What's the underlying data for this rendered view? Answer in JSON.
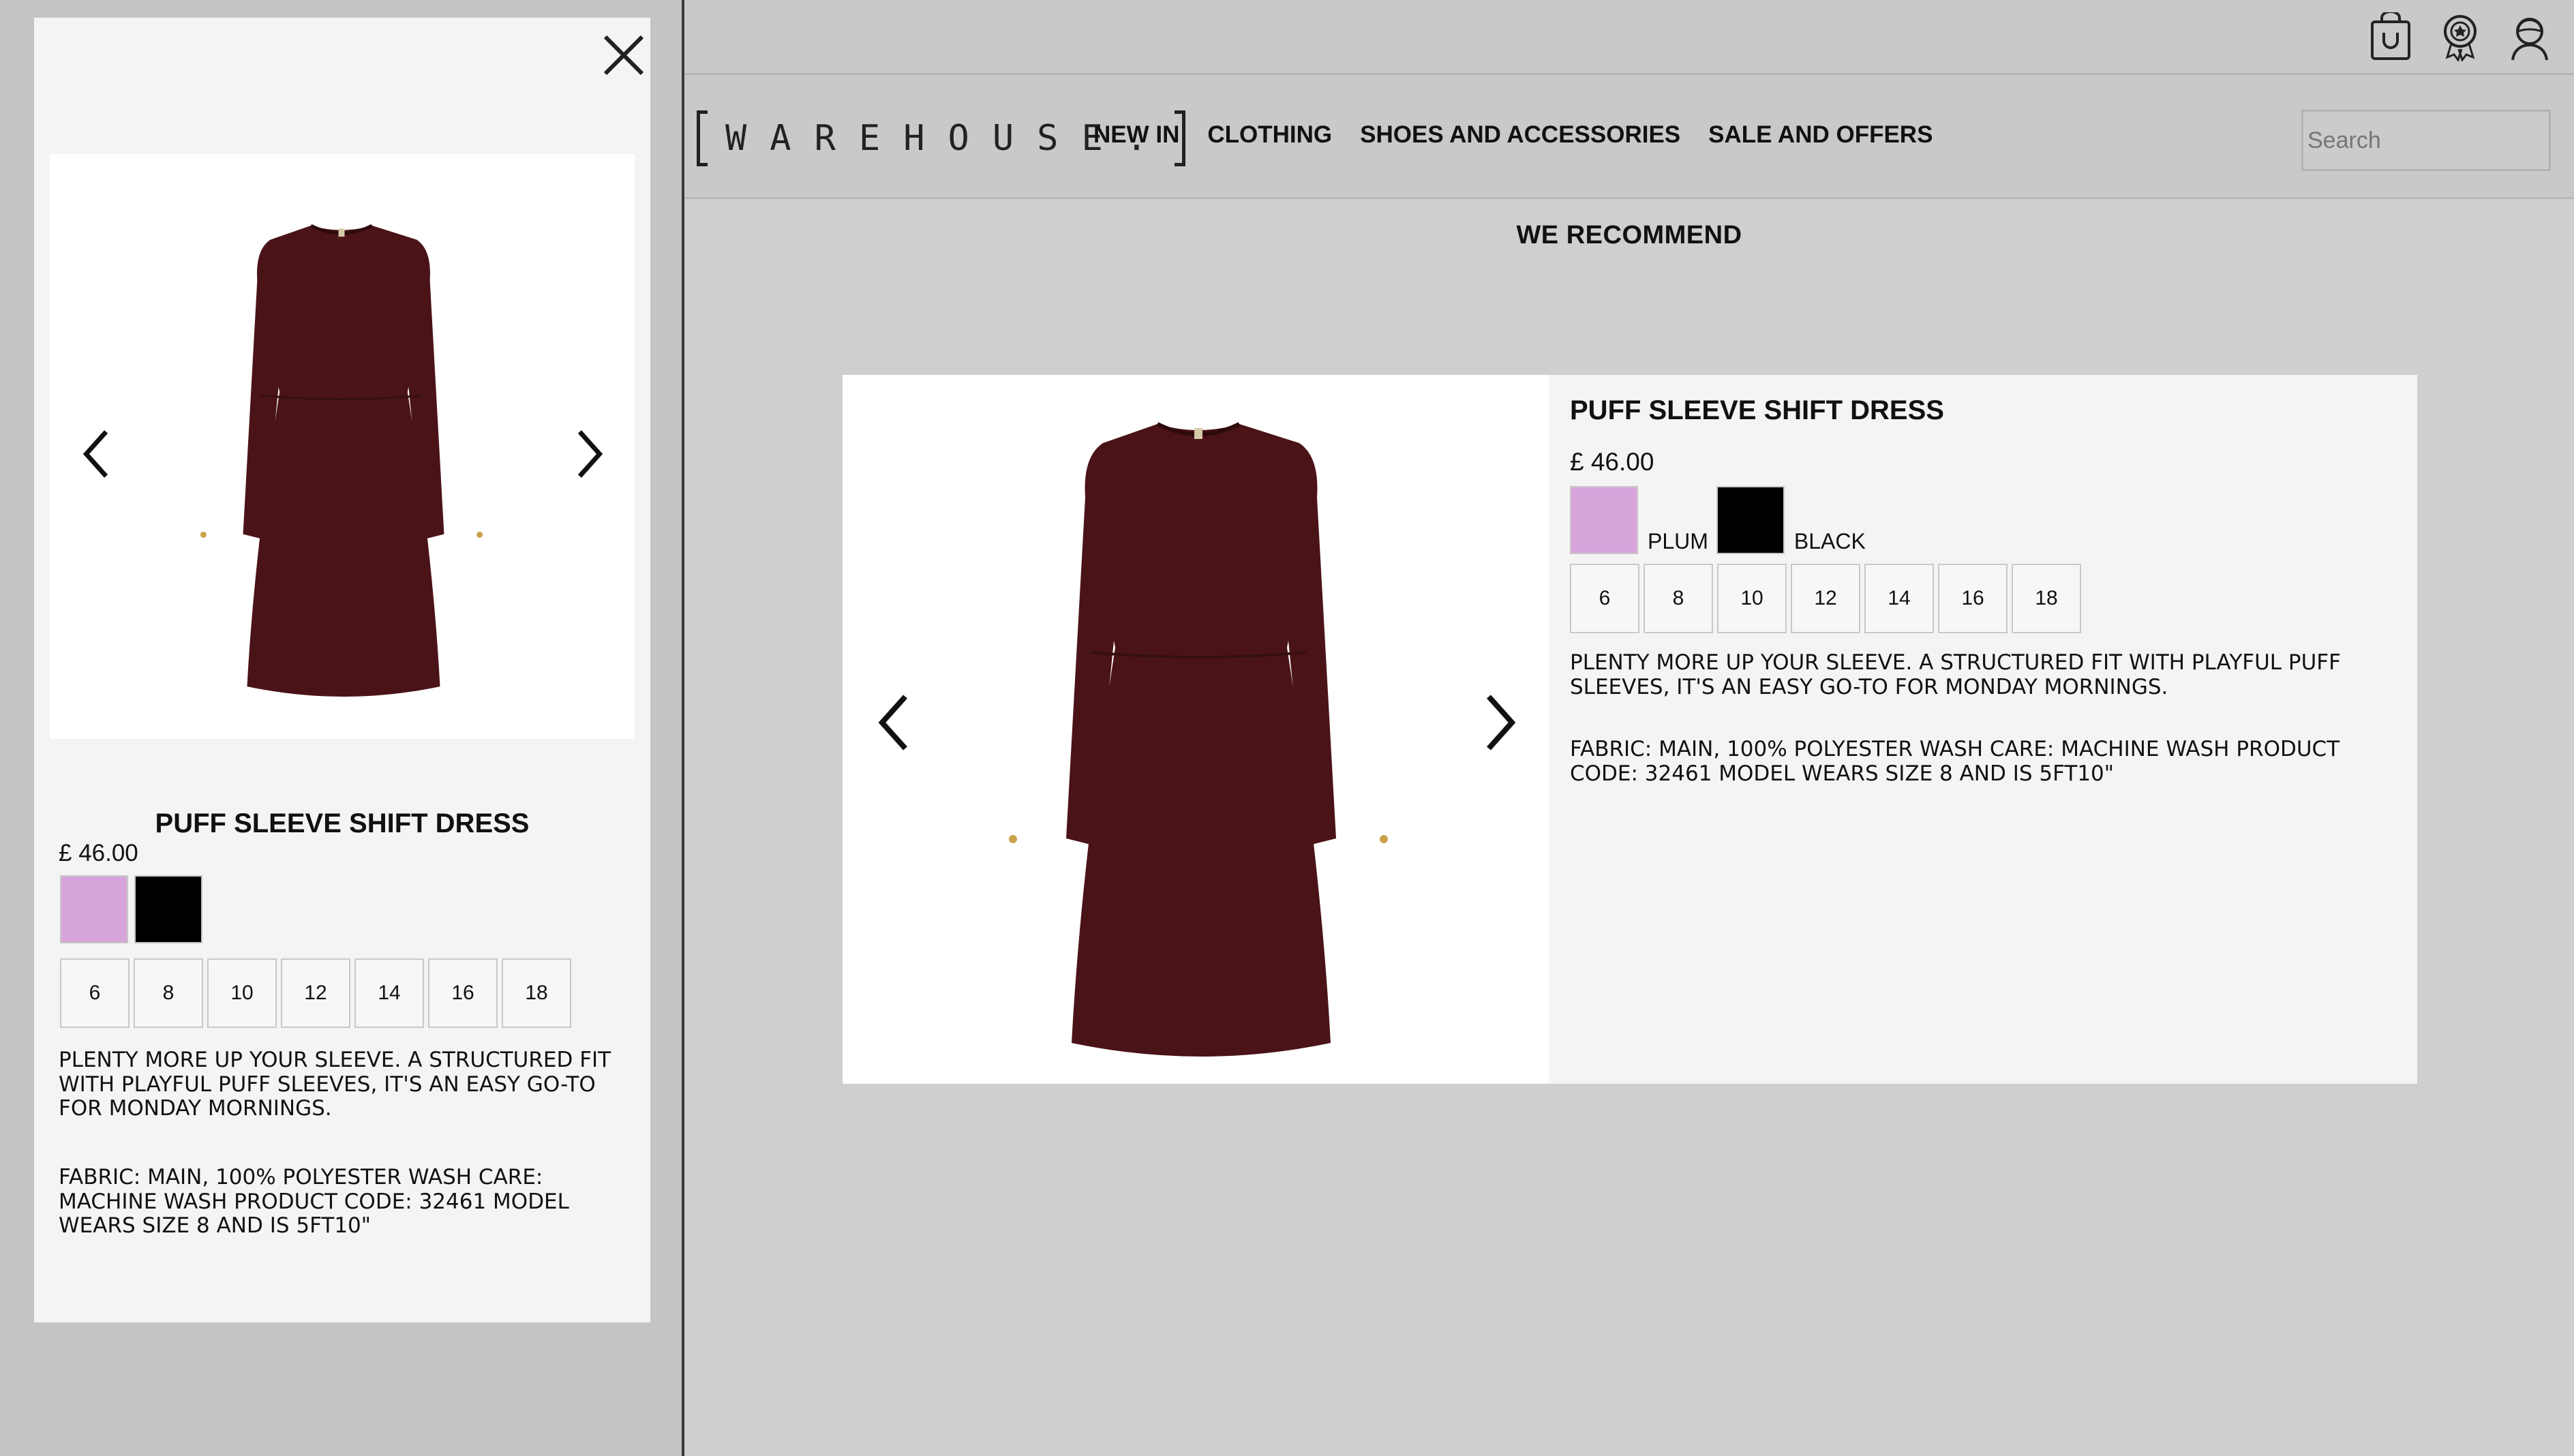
{
  "header": {
    "logo_text": "WAREHOUSE.",
    "icons": [
      "bag-icon",
      "rewards-badge-icon",
      "account-icon"
    ]
  },
  "nav": {
    "links": [
      "NEW IN",
      "CLOTHING",
      "SHOES AND ACCESSORIES",
      "SALE AND OFFERS"
    ]
  },
  "search": {
    "placeholder": "Search"
  },
  "recommend": {
    "title": "WE RECOMMEND"
  },
  "product": {
    "name": "PUFF SLEEVE SHIFT DRESS",
    "price": "£ 46.00",
    "colors": [
      {
        "label": "PLUM",
        "hex": "#d8a4dc"
      },
      {
        "label": "BLACK",
        "hex": "#000000"
      }
    ],
    "sizes": [
      "6",
      "8",
      "10",
      "12",
      "14",
      "16",
      "18"
    ],
    "description": "PLENTY MORE UP YOUR SLEEVE. A STRUCTURED FIT WITH PLAYFUL PUFF SLEEVES, IT'S AN EASY GO-TO FOR MONDAY MORNINGS.",
    "details": "FABRIC: MAIN, 100% POLYESTER WASH CARE: MACHINE WASH PRODUCT CODE: 32461 MODEL WEARS SIZE 8 AND IS 5FT10\"",
    "dress_color": "#4a1318"
  }
}
